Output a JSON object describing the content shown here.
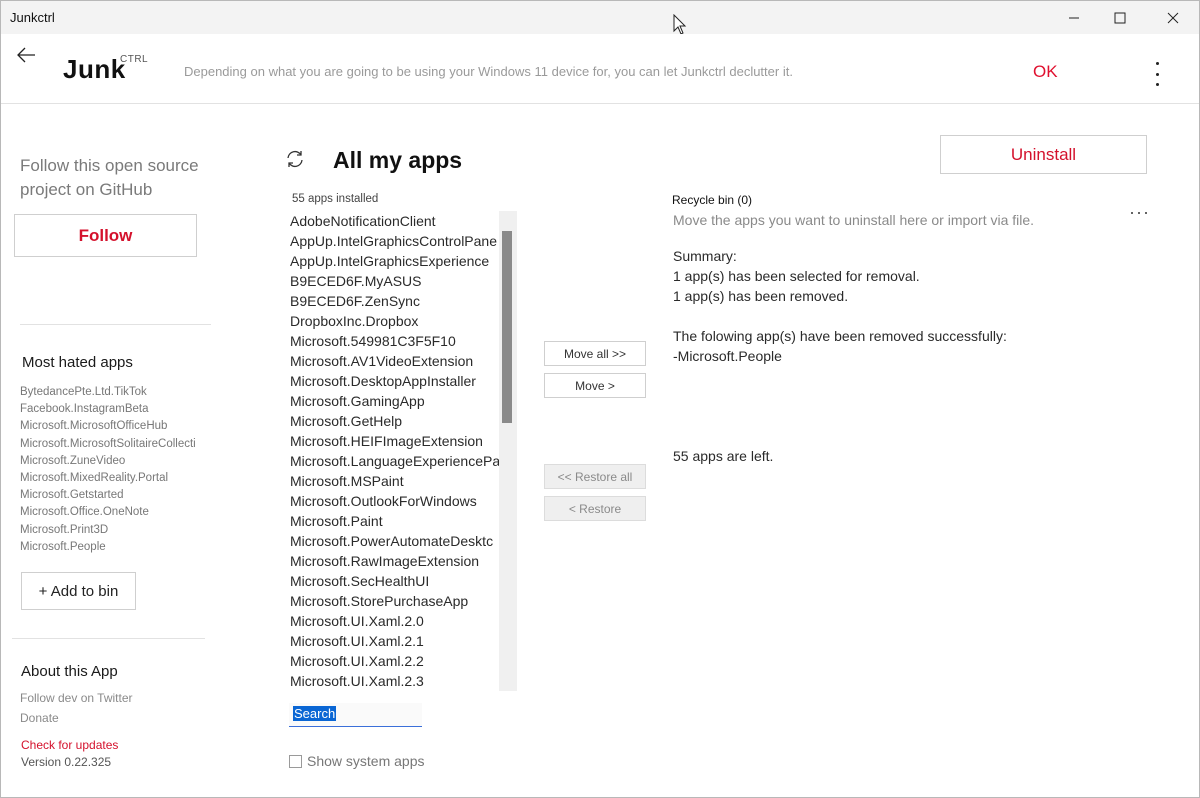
{
  "window": {
    "title": "Junkctrl"
  },
  "header": {
    "logo_main": "Junk",
    "logo_sup": "CTRL",
    "description": "Depending on what you are going to be using your Windows 11 device for, you can let Junkctrl declutter it.",
    "ok_label": "OK"
  },
  "sidebar": {
    "follow_text": "Follow this open source project on GitHub",
    "follow_label": "Follow",
    "hated_title": "Most hated apps",
    "hated_apps": [
      "BytedancePte.Ltd.TikTok",
      "Facebook.InstagramBeta",
      "Microsoft.MicrosoftOfficeHub",
      "Microsoft.MicrosoftSolitaireCollecti",
      "Microsoft.ZuneVideo",
      "Microsoft.MixedReality.Portal",
      "Microsoft.Getstarted",
      "Microsoft.Office.OneNote",
      "Microsoft.Print3D",
      "Microsoft.People"
    ],
    "add_to_bin_label": "+ Add to bin",
    "about_title": "About this App",
    "follow_dev": "Follow dev on Twitter",
    "donate": "Donate",
    "check_updates": "Check for updates",
    "version": "Version 0.22.325"
  },
  "main": {
    "title": "All my apps",
    "installed_count": "55 apps installed",
    "apps": [
      "AdobeNotificationClient",
      "AppUp.IntelGraphicsControlPane",
      "AppUp.IntelGraphicsExperience",
      "B9ECED6F.MyASUS",
      "B9ECED6F.ZenSync",
      "DropboxInc.Dropbox",
      "Microsoft.549981C3F5F10",
      "Microsoft.AV1VideoExtension",
      "Microsoft.DesktopAppInstaller",
      "Microsoft.GamingApp",
      "Microsoft.GetHelp",
      "Microsoft.HEIFImageExtension",
      "Microsoft.LanguageExperiencePa",
      "Microsoft.MSPaint",
      "Microsoft.OutlookForWindows",
      "Microsoft.Paint",
      "Microsoft.PowerAutomateDesktc",
      "Microsoft.RawImageExtension",
      "Microsoft.SecHealthUI",
      "Microsoft.StorePurchaseApp",
      "Microsoft.UI.Xaml.2.0",
      "Microsoft.UI.Xaml.2.1",
      "Microsoft.UI.Xaml.2.2",
      "Microsoft.UI.Xaml.2.3"
    ],
    "search_value": "Search",
    "show_system_label": "Show system apps",
    "show_system_checked": false,
    "buttons": {
      "move_all": "Move all >>",
      "move": "Move >",
      "restore_all": "<< Restore all",
      "restore": "< Restore"
    },
    "uninstall_label": "Uninstall"
  },
  "bin": {
    "title": "Recycle bin (0)",
    "hint": "Move the apps you want to uninstall here or import via file.",
    "summary_lines": [
      "Summary:",
      "1 app(s) has been selected for removal.",
      "1 app(s) has been removed."
    ],
    "removed_lines": [
      "The folowing app(s) have been removed successfully:",
      "-Microsoft.People"
    ],
    "left_text": "55 apps are left."
  },
  "colors": {
    "accent": "#d4112c",
    "selection": "#0a66d4",
    "muted_text": "#8a8a8a"
  },
  "icons": [
    "back-arrow-icon",
    "refresh-icon",
    "more-vertical-icon",
    "more-horizontal-icon",
    "minimize-icon",
    "maximize-icon",
    "close-icon"
  ]
}
